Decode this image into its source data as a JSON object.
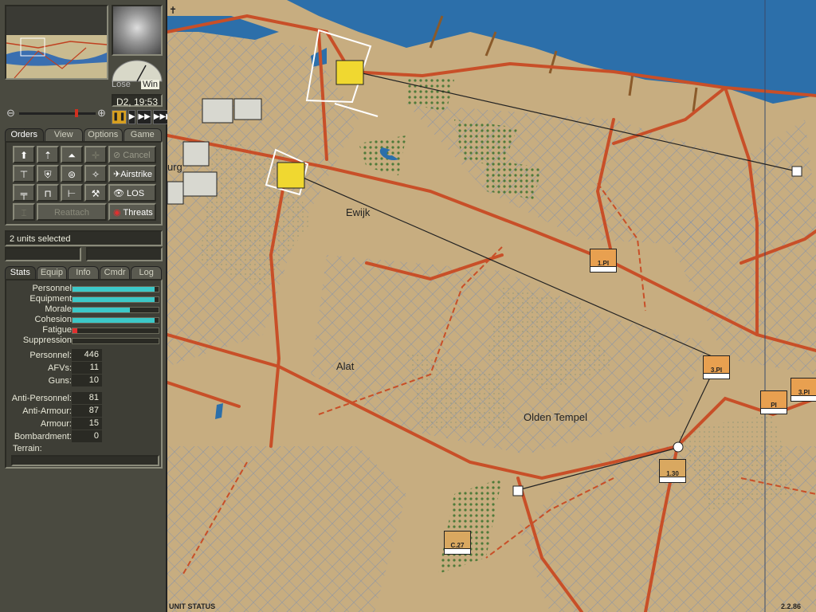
{
  "panel": {
    "gauge": {
      "lose_label": "Lose",
      "win_label": "Win"
    },
    "clock": "D2, 19:53",
    "speed_buttons": [
      "❚❚",
      "▶",
      "▶▶",
      "▶▶▶"
    ],
    "tabs": [
      "Orders",
      "View",
      "Options",
      "Game"
    ],
    "order_buttons": {
      "cancel": "Cancel",
      "airstrike": "Airstrike",
      "los": "LOS",
      "reattach": "Reattach",
      "threats": "Threats"
    },
    "selection": "2 units selected",
    "stat_tabs": [
      "Stats",
      "Equip",
      "Info",
      "Cmdr",
      "Log"
    ],
    "bars": [
      {
        "label": "Personnel",
        "fraction": 0.95,
        "color": "#3cc8c8"
      },
      {
        "label": "Equipment",
        "fraction": 0.95,
        "color": "#3cc8c8"
      },
      {
        "label": "Morale",
        "fraction": 0.67,
        "color": "#3cc8c8"
      },
      {
        "label": "Cohesion",
        "fraction": 0.95,
        "color": "#3cc8c8"
      },
      {
        "label": "Fatigue",
        "fraction": 0.06,
        "color": "#e03030"
      },
      {
        "label": "Suppression",
        "fraction": 0.0,
        "color": "#3cc8c8"
      }
    ],
    "numbers": [
      {
        "label": "Personnel:",
        "value": "446"
      },
      {
        "label": "AFVs:",
        "value": "11"
      },
      {
        "label": "Guns:",
        "value": "10"
      },
      {
        "label": "Anti-Personnel:",
        "value": "81"
      },
      {
        "label": "Anti-Armour:",
        "value": "87"
      },
      {
        "label": "Armour:",
        "value": "15"
      },
      {
        "label": "Bombardment:",
        "value": "0"
      }
    ],
    "terrain_label": "Terrain:"
  },
  "map": {
    "places": [
      "Ewijk",
      "Alat",
      "Olden Tempel",
      "urg"
    ],
    "status_label": "UNIT STATUS",
    "version": "2.2.86",
    "units": [
      {
        "label": "1.PI",
        "side": "enemy"
      },
      {
        "label": "3.PI",
        "side": "enemy"
      },
      {
        "label": "3.PI",
        "side": "enemy"
      },
      {
        "label": "PI",
        "side": "enemy"
      },
      {
        "label": "1.30",
        "side": "enemy"
      },
      {
        "label": "C.27",
        "side": "enemy"
      }
    ]
  }
}
